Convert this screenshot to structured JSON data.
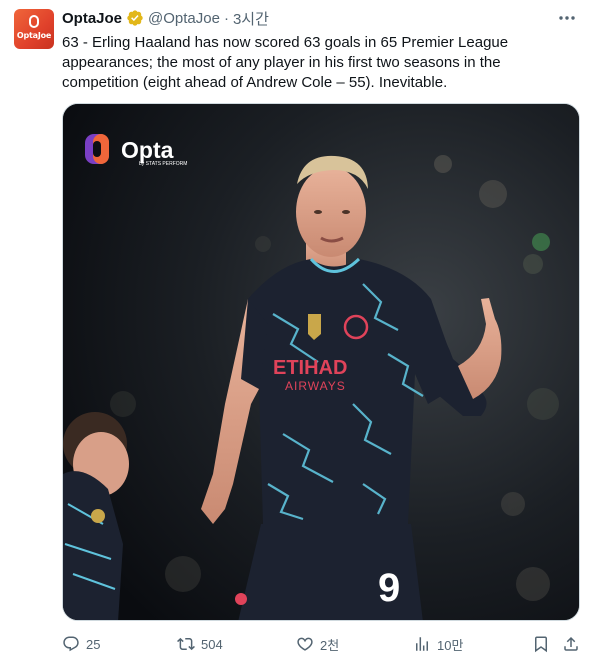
{
  "avatar": {
    "label": "OptaJoe",
    "color": "#e8502f"
  },
  "author": {
    "display_name": "OptaJoe",
    "handle": "@OptaJoe",
    "separator": "·",
    "time": "3시간",
    "verified": true,
    "verified_color": "#e2b719"
  },
  "tweet": {
    "text": "63 - Erling Haaland has now scored 63 goals in 65 Premier League appearances; the most of any player in his first two seasons in the competition (eight ahead of Andrew Cole – 55). Inevitable."
  },
  "media": {
    "watermark_title": "Opta",
    "watermark_subtitle": "by STATS PERFORM",
    "shirt_sponsor_line1": "ETIHAD",
    "shirt_sponsor_line2": "AIRWAYS",
    "shorts_number": "9",
    "colors": {
      "kit": "#1c2230",
      "kit_accent": "#5fc3dc",
      "sponsor": "#e0435a"
    }
  },
  "actions": {
    "replies": "25",
    "reposts": "504",
    "likes": "2천",
    "views": "10만"
  },
  "icons": [
    "verified-badge-icon",
    "more-icon",
    "reply-icon",
    "repost-icon",
    "like-icon",
    "views-icon",
    "bookmark-icon",
    "share-icon"
  ]
}
